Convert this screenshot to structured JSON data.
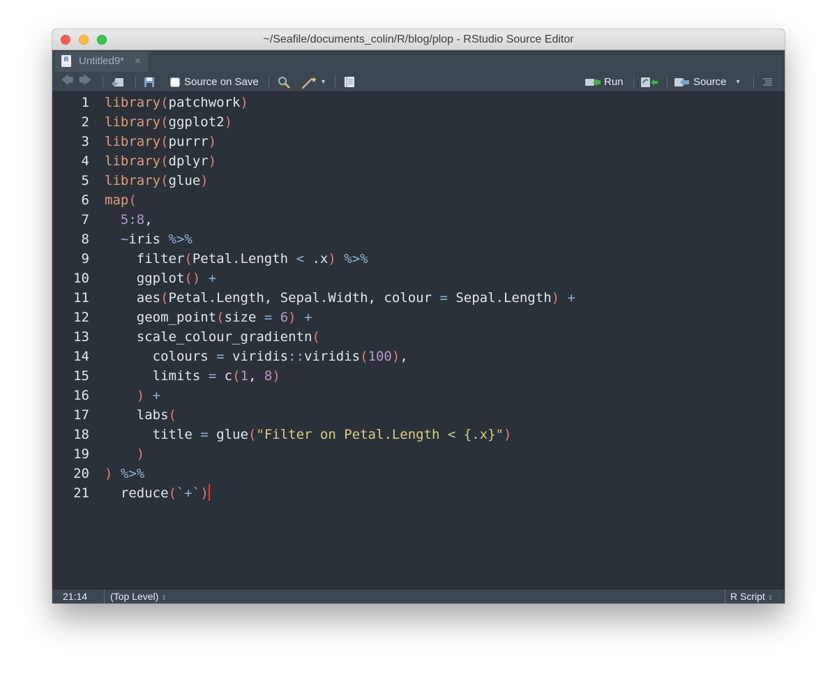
{
  "window": {
    "title": "~/Seafile/documents_colin/R/blog/plop - RStudio Source Editor"
  },
  "tab": {
    "icon_letter": "R",
    "label": "Untitled9*",
    "close": "×"
  },
  "toolbar": {
    "back": "🡄",
    "forward": "🡆",
    "source_on_save_label": "Source on Save",
    "source_on_save_checked": false,
    "run_label": "Run",
    "source_label": "Source",
    "dropdown": "▾"
  },
  "editor": {
    "line_numbers": [
      "1",
      "2",
      "3",
      "4",
      "5",
      "6",
      "7",
      "8",
      "9",
      "10",
      "11",
      "12",
      "13",
      "14",
      "15",
      "16",
      "17",
      "18",
      "19",
      "20",
      "21"
    ],
    "lines": [
      "library(patchwork)",
      "library(ggplot2)",
      "library(purrr)",
      "library(dplyr)",
      "library(glue)",
      "map(",
      "  5:8,",
      "  ~iris %>%",
      "    filter(Petal.Length < .x) %>%",
      "    ggplot() +",
      "    aes(Petal.Length, Sepal.Width, colour = Sepal.Length) +",
      "    geom_point(size = 6) +",
      "    scale_colour_gradientn(",
      "      colours = viridis::viridis(100),",
      "      limits = c(1, 8)",
      "    ) +",
      "    labs(",
      "      title = glue(\"Filter on Petal.Length < {.x}\")",
      "    )",
      ") %>%",
      "  reduce(`+`)"
    ],
    "cursor_line": 21
  },
  "status": {
    "position": "21:14",
    "scope": "(Top Level)",
    "file_type": "R Script",
    "updown": "⇕"
  },
  "colors": {
    "background": "#2b3138",
    "function": "#e19b7a",
    "paren": "#e87c74",
    "operator": "#8fb2d6",
    "number": "#b596d1",
    "string": "#d9cc85",
    "text": "#e2e6e9"
  }
}
